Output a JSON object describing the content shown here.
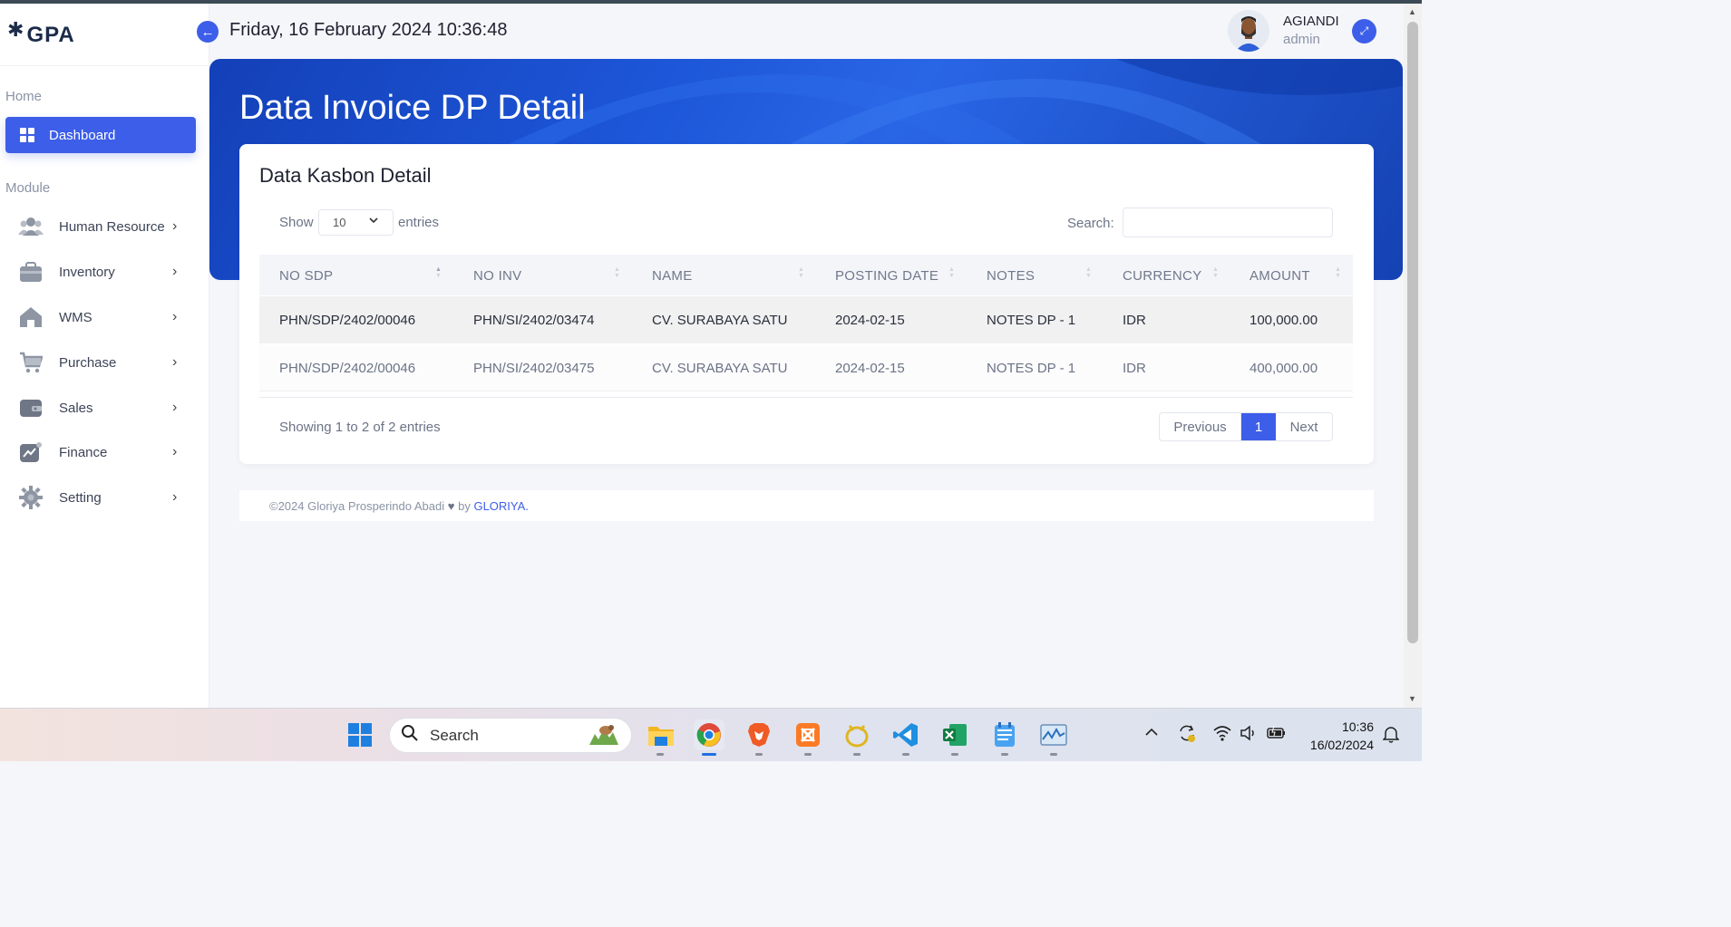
{
  "app": {
    "logo_text": "GPA",
    "datetime": "Friday, 16 February 2024 10:36:48",
    "user_name": "AGIANDI",
    "user_role": "admin"
  },
  "sidebar": {
    "home_section": "Home",
    "dashboard_label": "Dashboard",
    "module_section": "Module",
    "items": [
      {
        "label": "Human Resource",
        "icon": "users-icon"
      },
      {
        "label": "Inventory",
        "icon": "briefcase-icon"
      },
      {
        "label": "WMS",
        "icon": "home-icon"
      },
      {
        "label": "Purchase",
        "icon": "cart-icon"
      },
      {
        "label": "Sales",
        "icon": "wallet-icon"
      },
      {
        "label": "Finance",
        "icon": "chart-icon"
      },
      {
        "label": "Setting",
        "icon": "gear-icon"
      }
    ]
  },
  "page": {
    "title": "Data Invoice DP Detail",
    "card_title": "Data Kasbon Detail"
  },
  "table_controls": {
    "show_label": "Show",
    "entries_value": "10",
    "entries_label": "entries",
    "search_label": "Search:",
    "search_value": ""
  },
  "table": {
    "columns": [
      "NO SDP",
      "NO INV",
      "NAME",
      "POSTING DATE",
      "NOTES",
      "CURRENCY",
      "AMOUNT"
    ],
    "rows": [
      [
        "PHN/SDP/2402/00046",
        "PHN/SI/2402/03474",
        "CV. SURABAYA SATU",
        "2024-02-15",
        "NOTES DP - 1",
        "IDR",
        "100,000.00"
      ],
      [
        "PHN/SDP/2402/00046",
        "PHN/SI/2402/03475",
        "CV. SURABAYA SATU",
        "2024-02-15",
        "NOTES DP - 1",
        "IDR",
        "400,000.00"
      ]
    ],
    "info": "Showing 1 to 2 of 2 entries",
    "pagination": {
      "previous": "Previous",
      "current": "1",
      "next": "Next"
    }
  },
  "footer": {
    "copyright": "©2024 Gloriya Prosperindo Abadi",
    "by": "by",
    "brand": "GLORIYA."
  },
  "taskbar": {
    "search_placeholder": "Search",
    "time": "10:36",
    "date": "16/02/2024"
  },
  "colors": {
    "accent": "#3d5ee8",
    "banner": "#1d56d8",
    "sidebar_bg": "#ffffff",
    "page_bg": "#f5f6fa"
  }
}
